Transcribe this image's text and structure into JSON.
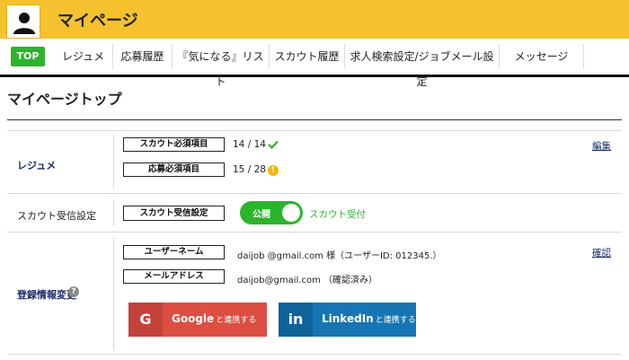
{
  "header": {
    "title": "マイページ",
    "bg_color": "#f5c12e"
  },
  "nav": {
    "items": [
      {
        "label": "TOP",
        "active": true
      },
      {
        "label": "レジュメ"
      },
      {
        "label": "応募履歴"
      },
      {
        "label": "『気になる』リスト"
      },
      {
        "label": "スカウト履歴"
      },
      {
        "label": "求人検索設定/ジョブメール設定"
      },
      {
        "label": "メッセージ"
      }
    ]
  },
  "page_title": "マイページトップ",
  "resume": {
    "label": "レジュメ",
    "edit_link": "編集",
    "scout_required": {
      "tag": "スカウト必須項目",
      "value": "14 / 14",
      "status_icon": "check-icon"
    },
    "apply_required": {
      "tag": "応募必須項目",
      "value": "15 / 28",
      "status_icon": "warning-icon"
    }
  },
  "scout_setting": {
    "label": "スカウト受信設定",
    "tag": "スカウト受信設定",
    "toggle_label": "公開",
    "toggle_on": true,
    "status_text": "スカウト受付",
    "accent_color": "#2bb52b"
  },
  "account": {
    "label": "登録情報変更",
    "help_icon": "?",
    "confirm_link": "確認",
    "username": {
      "tag": "ユーザーネーム",
      "value": "daijob @gmail.com 様（ユーザーID: 012345.）"
    },
    "email": {
      "tag": "メールアドレス",
      "value": "daijob@gmail.com （確認済み）"
    },
    "google": {
      "mark": "G",
      "label": "Google",
      "suffix": "と連携する",
      "color": "#dc4e41"
    },
    "linkedin": {
      "mark": "in",
      "label": "LinkedIn",
      "suffix": "と連携する",
      "color": "#1675b2"
    }
  }
}
